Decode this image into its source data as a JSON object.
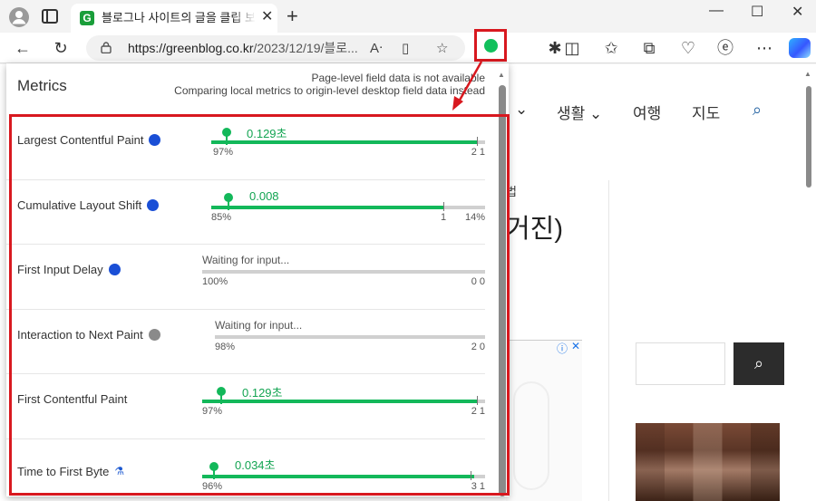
{
  "browser": {
    "tab_title": "블로그나 사이트의 글을 클립 보드",
    "tab_close": "✕",
    "new_tab": "+",
    "url_domain": "https://greenblog.co.kr",
    "url_path": "/2023/12/19/블로...",
    "window_controls": [
      "—",
      "☐",
      "✕"
    ],
    "accent": "#12c05c"
  },
  "webpage": {
    "nav": [
      {
        "label": "⌄"
      },
      {
        "label": "생활 ⌄"
      },
      {
        "label": "여행"
      },
      {
        "label": "지도"
      }
    ],
    "post_small": "법",
    "post_big": "거진)",
    "ad_label": "ⓘ",
    "ad_close": "✕"
  },
  "popup": {
    "title": "Metrics",
    "note_line1": "Page-level field data is not available",
    "note_line2": "Comparing local metrics to origin-level desktop field data instead",
    "metrics": [
      {
        "name": "Largest Contentful Paint",
        "status_color": "#1a4fd6",
        "value": "0.129초",
        "waiting": "",
        "pct": "97%",
        "right": "2 1",
        "good_fraction": 0.97
      },
      {
        "name": "Cumulative Layout Shift",
        "status_color": "#1a4fd6",
        "value": "0.008",
        "waiting": "",
        "pct": "85%",
        "mid": "1",
        "right": "14%",
        "good_fraction": 0.85
      },
      {
        "name": "First Input Delay",
        "status_color": "#1a4fd6",
        "value": "",
        "waiting": "Waiting for input...",
        "pct": "100%",
        "right": "0 0",
        "good_fraction": 1.0
      },
      {
        "name": "Interaction to Next Paint",
        "status_color": "#8a8a8a",
        "value": "",
        "waiting": "Waiting for input...",
        "pct": "98%",
        "right": "2 0",
        "good_fraction": 0.98
      },
      {
        "name": "First Contentful Paint",
        "status_color": "",
        "value": "0.129초",
        "waiting": "",
        "pct": "97%",
        "right": "2 1",
        "good_fraction": 0.97
      },
      {
        "name": "Time to First Byte",
        "status_color": "",
        "experimental_icon": "⚗",
        "value": "0.034초",
        "waiting": "",
        "pct": "96%",
        "right": "3 1",
        "good_fraction": 0.96
      }
    ]
  },
  "colors": {
    "good": "#13b85a",
    "highlight": "#d8181f",
    "blue_dot": "#1a4fd6",
    "gray_dot": "#8a8a8a"
  }
}
